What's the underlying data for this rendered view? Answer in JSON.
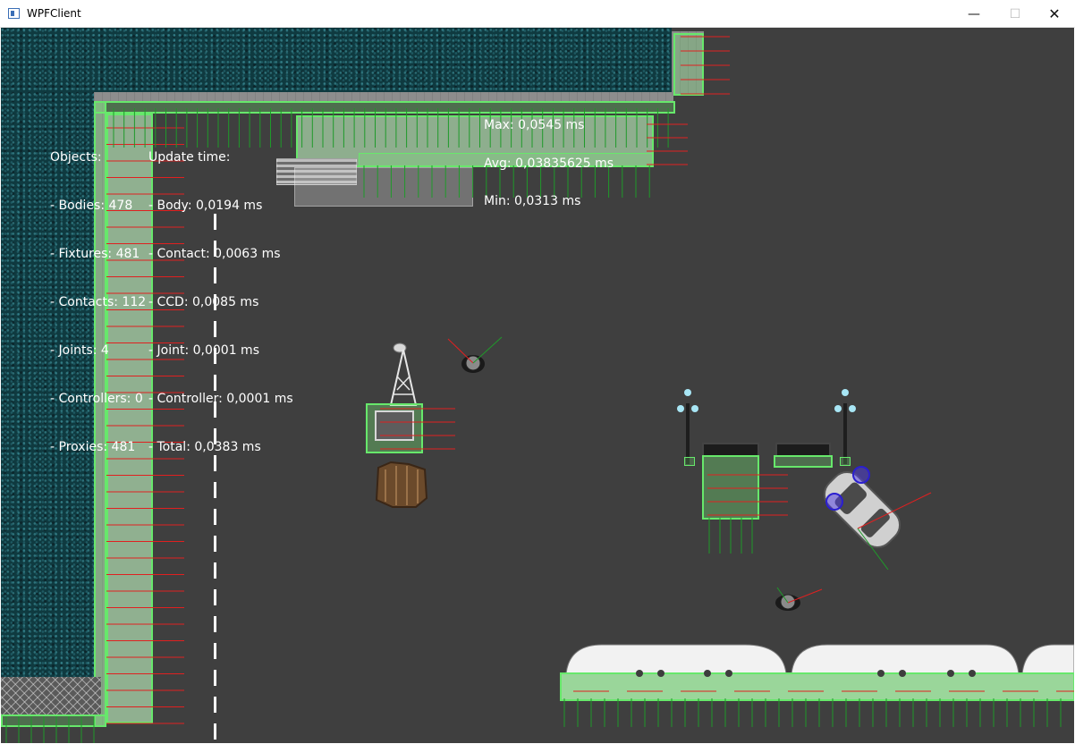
{
  "window": {
    "title": "WPFClient",
    "minimize_glyph": "—",
    "maximize_glyph": "☐",
    "close_glyph": "✕"
  },
  "stats": {
    "objects": {
      "header": "Objects:",
      "bodies": "- Bodies: 478",
      "fixtures": "- Fixtures: 481",
      "contacts": "- Contacts: 112",
      "joints": "- Joints: 4",
      "controllers": "- Controllers: 0",
      "proxies": "- Proxies: 481"
    },
    "update_time": {
      "header": "Update time:",
      "body": "- Body: 0,0194 ms",
      "contact": "- Contact: 0,0063 ms",
      "ccd": "- CCD: 0,0085 ms",
      "joint": "- Joint: 0,0001 ms",
      "controller": "- Controller: 0,0001 ms",
      "total": "- Total: 0,0383 ms"
    },
    "timing": {
      "max": "Max: 0,0545 ms",
      "avg": "Avg: 0,03835625 ms",
      "min": "Min: 0,0313 ms"
    }
  },
  "colors": {
    "water": "#0f3a40",
    "road": "#3f3f3f",
    "hitbox": "#67e86b",
    "debug_x_axis": "#e02020",
    "debug_y_axis": "#1f9a2a",
    "wheel": "#3a2fd0"
  },
  "scene": {
    "objects": [
      "water-left",
      "sidewalk-top",
      "sidewalk-left",
      "radio-tower",
      "crate",
      "tree-stump",
      "pedestrian",
      "street-lamp",
      "bench",
      "car",
      "train",
      "fence"
    ]
  }
}
